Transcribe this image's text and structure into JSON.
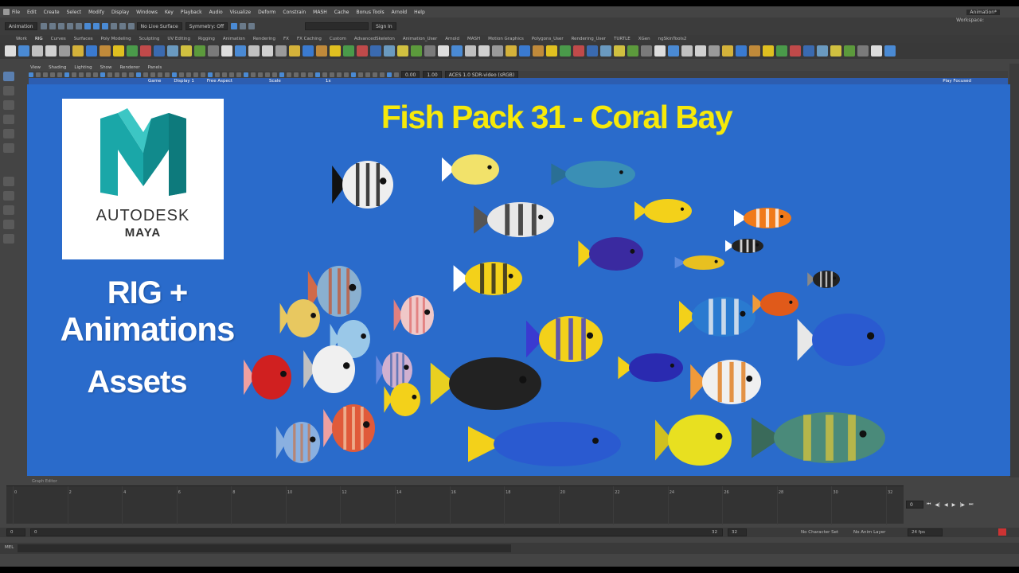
{
  "menu": [
    "File",
    "Edit",
    "Create",
    "Select",
    "Modify",
    "Display",
    "Windows",
    "Key",
    "Playback",
    "Audio",
    "Visualize",
    "Deform",
    "Constrain",
    "MASH",
    "Cache",
    "Bonus Tools",
    "Arnold",
    "Help"
  ],
  "workspace": {
    "label": "Workspace:",
    "value": "Animation*"
  },
  "status_line": {
    "mode": "Animation",
    "live_surface": "No Live Surface",
    "symmetry": "Symmetry: Off",
    "sign_in": "Sign In"
  },
  "shelf_tabs": [
    "Work",
    "RIG",
    "Curves",
    "Surfaces",
    "Poly Modeling",
    "Sculpting",
    "UV Editing",
    "Rigging",
    "Animation",
    "Rendering",
    "FX",
    "FX Caching",
    "Custom",
    "AdvancedSkeleton",
    "Animation_User",
    "Arnold",
    "MASH",
    "Motion Graphics",
    "Polygons_User",
    "Rendering_User",
    "TURTLE",
    "XGen",
    "ngSkinTools2"
  ],
  "active_shelf_tab": "RIG",
  "panel_menu": [
    "View",
    "Shading",
    "Lighting",
    "Show",
    "Renderer",
    "Panels"
  ],
  "panel_hud": {
    "camera": "Game",
    "display": "Display 1",
    "aspect": "Free Aspect",
    "scale": "Scale",
    "zoom": "1x",
    "focus": "Play Focused",
    "field1": "0.00",
    "field2": "1.00",
    "color": "ACES 1.0 SDR-video (sRGB)"
  },
  "viewport": {
    "title": "Fish Pack 31 - Coral Bay",
    "logo_brand": "AUTODESK",
    "logo_product": "MAYA",
    "tagline_1": "RIG +",
    "tagline_2": "Animations",
    "tagline_3": "Assets"
  },
  "graph_editor_label": "Graph Editor",
  "timeline": {
    "frames": [
      "0",
      "2",
      "4",
      "6",
      "8",
      "10",
      "12",
      "14",
      "16",
      "18",
      "20",
      "22",
      "24",
      "26",
      "28",
      "30",
      "32"
    ],
    "current_frame": "0"
  },
  "range": {
    "start": "0",
    "start2": "0",
    "end": "32",
    "end2": "32",
    "character_set": "No Character Set",
    "anim_layer": "No Anim Layer",
    "fps": "24 fps"
  },
  "mel_label": "MEL",
  "colors": {
    "viewport_bg": "#2a6bcb",
    "title": "#f6e90a",
    "maya_teal": "#1aa7a8"
  }
}
